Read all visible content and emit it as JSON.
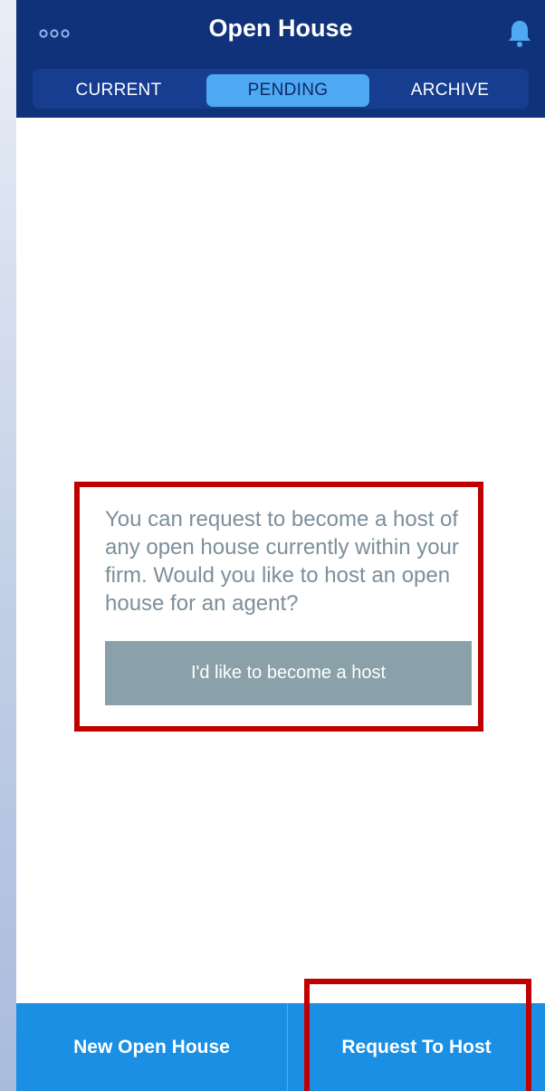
{
  "header": {
    "title": "Open House",
    "left_icon": "more-options-icon",
    "right_icon": "bell-icon"
  },
  "tabs": [
    {
      "label": "CURRENT",
      "selected": false
    },
    {
      "label": "PENDING",
      "selected": true
    },
    {
      "label": "ARCHIVE",
      "selected": false
    }
  ],
  "main": {
    "message": "You can request to become a host of any open house currently within your firm. Would you like to host an open house for an agent?",
    "host_button_label": "I'd like to become a host"
  },
  "bottom_bar": {
    "new_open_house_label": "New Open House",
    "request_to_host_label": "Request To Host"
  },
  "colors": {
    "header_bg": "#10327a",
    "tab_selected_bg": "#4ea9f2",
    "bottom_bar_bg": "#1a8fe3",
    "host_button_bg": "#8aa1a9",
    "message_text": "#7c8f9a",
    "annotation": "#c00000"
  }
}
